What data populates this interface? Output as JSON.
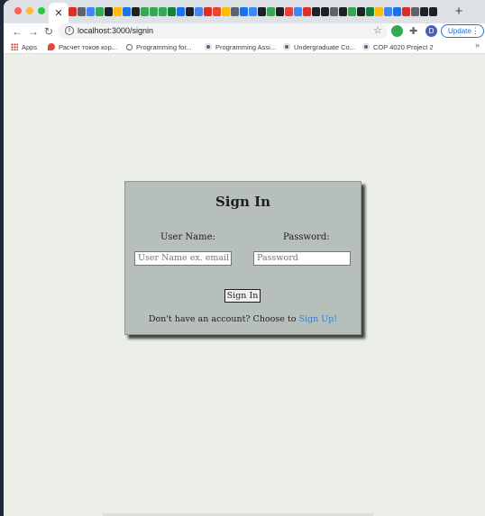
{
  "window": {
    "active_tab_icon": "close-icon",
    "new_tab_label": "+"
  },
  "tab_favicon_colors": [
    "#d93025",
    "#5f6368",
    "#4285f4",
    "#34a853",
    "#202124",
    "#fbbc04",
    "#1a73e8",
    "#202124",
    "#34a853",
    "#34a853",
    "#34a853",
    "#188038",
    "#1a73e8",
    "#202124",
    "#4285f4",
    "#d93025",
    "#ea4335",
    "#fbbc04",
    "#5f6368",
    "#1a73e8",
    "#4285f4",
    "#202124",
    "#34a853",
    "#202124",
    "#ea4335",
    "#4285f4",
    "#d93025",
    "#202124",
    "#202124",
    "#5f6368",
    "#202124",
    "#34a853",
    "#202124",
    "#188038",
    "#fbbc04",
    "#4285f4",
    "#1a73e8",
    "#d93025",
    "#5f6368",
    "#202124",
    "#202124"
  ],
  "toolbar": {
    "url": "localhost:3000/signin",
    "update_label": "Update",
    "profile_initial": "D"
  },
  "bookmarks": [
    {
      "label": "Apps",
      "icon": "apps-icon"
    },
    {
      "label": "Расчет токов кор...",
      "icon": "fire-icon"
    },
    {
      "label": "Programming for...",
      "icon": "search-icon"
    },
    {
      "label": "Programming Assi...",
      "icon": "globe-icon"
    },
    {
      "label": "Undergraduate Co...",
      "icon": "globe-icon"
    },
    {
      "label": "COP 4020 Project 2",
      "icon": "globe-icon"
    }
  ],
  "signin": {
    "title": "Sign In",
    "username_label": "User Name:",
    "password_label": "Password:",
    "username_placeholder": "User Name ex. email address",
    "password_placeholder": "Password",
    "submit_label": "Sign In",
    "signup_prompt": "Don't have an account? Choose to",
    "signup_link": "Sign Up!"
  },
  "colors": {
    "card_bg": "#b7bfbb",
    "page_bg": "#eceee8",
    "link": "#2f7fd8"
  }
}
